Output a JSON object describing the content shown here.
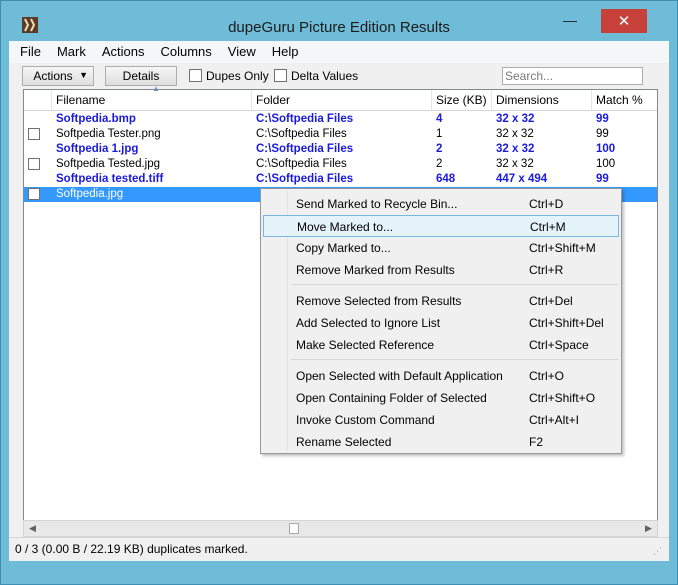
{
  "window": {
    "title": "dupeGuru Picture Edition Results",
    "close_glyph": "✕",
    "min_glyph": "—"
  },
  "menubar": [
    {
      "label": "File"
    },
    {
      "label": "Mark"
    },
    {
      "label": "Actions"
    },
    {
      "label": "Columns"
    },
    {
      "label": "View"
    },
    {
      "label": "Help"
    }
  ],
  "toolbar": {
    "actions_label": "Actions",
    "details_label": "Details",
    "dupes_only_label": "Dupes Only",
    "delta_values_label": "Delta Values",
    "search_placeholder": "Search..."
  },
  "table": {
    "headers": [
      "Filename",
      "Folder",
      "Size (KB)",
      "Dimensions",
      "Match %"
    ],
    "rows": [
      {
        "filename": "Softpedia.bmp",
        "folder": "C:\\Softpedia Files",
        "size": "4",
        "dimensions": "32 x 32",
        "match": "99",
        "kind": "ref"
      },
      {
        "filename": "Softpedia Tester.png",
        "folder": "C:\\Softpedia Files",
        "size": "1",
        "dimensions": "32 x 32",
        "match": "99",
        "kind": "dupe"
      },
      {
        "filename": "Softpedia 1.jpg",
        "folder": "C:\\Softpedia Files",
        "size": "2",
        "dimensions": "32 x 32",
        "match": "100",
        "kind": "ref"
      },
      {
        "filename": "Softpedia Tested.jpg",
        "folder": "C:\\Softpedia Files",
        "size": "2",
        "dimensions": "32 x 32",
        "match": "100",
        "kind": "dupe"
      },
      {
        "filename": "Softpedia tested.tiff",
        "folder": "C:\\Softpedia Files",
        "size": "648",
        "dimensions": "447 x 494",
        "match": "99",
        "kind": "ref"
      },
      {
        "filename": "Softpedia.jpg",
        "folder": "",
        "size": "",
        "dimensions": "",
        "match": "",
        "kind": "dupe-selected"
      }
    ]
  },
  "context_menu": {
    "groups": [
      [
        {
          "label": "Send Marked to Recycle Bin...",
          "shortcut": "Ctrl+D"
        },
        {
          "label": "Move Marked to...",
          "shortcut": "Ctrl+M",
          "hover": true
        },
        {
          "label": "Copy Marked to...",
          "shortcut": "Ctrl+Shift+M"
        },
        {
          "label": "Remove Marked from Results",
          "shortcut": "Ctrl+R"
        }
      ],
      [
        {
          "label": "Remove Selected from Results",
          "shortcut": "Ctrl+Del"
        },
        {
          "label": "Add Selected to Ignore List",
          "shortcut": "Ctrl+Shift+Del"
        },
        {
          "label": "Make Selected Reference",
          "shortcut": "Ctrl+Space"
        }
      ],
      [
        {
          "label": "Open Selected with Default Application",
          "shortcut": "Ctrl+O"
        },
        {
          "label": "Open Containing Folder of Selected",
          "shortcut": "Ctrl+Shift+O"
        },
        {
          "label": "Invoke Custom Command",
          "shortcut": "Ctrl+Alt+I"
        },
        {
          "label": "Rename Selected",
          "shortcut": "F2"
        }
      ]
    ]
  },
  "status": {
    "text": "0 / 3 (0.00 B / 22.19 KB) duplicates marked."
  },
  "colors": {
    "reference_text": "#1a1adb",
    "selection": "#3399ff",
    "frame": "#6fbcd9",
    "close_button": "#c7403a"
  }
}
